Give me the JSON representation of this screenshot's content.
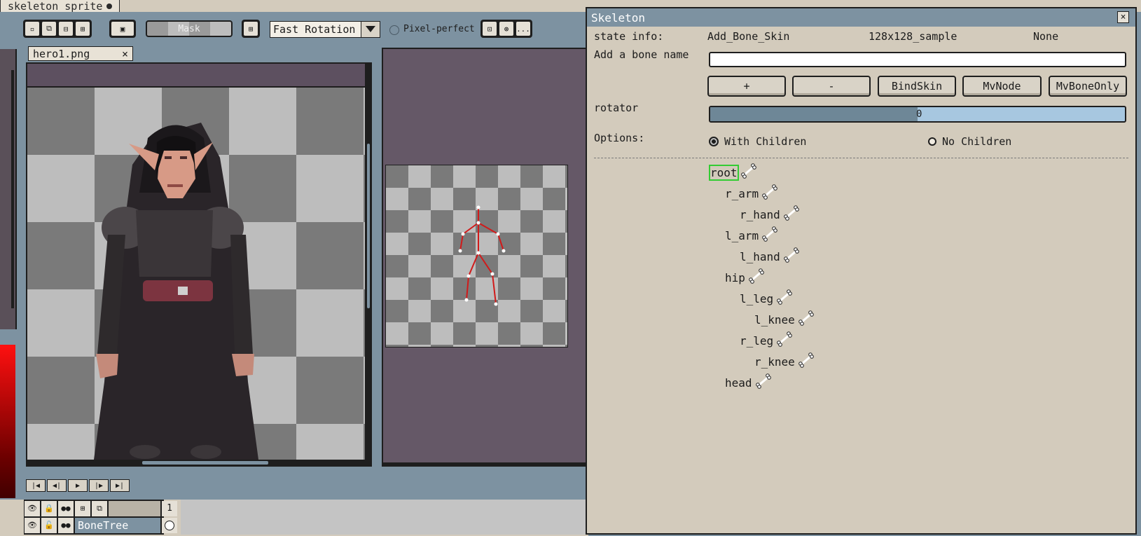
{
  "tab": {
    "title": "skeleton_sprite"
  },
  "toolbar": {
    "mask_label": "Mask",
    "rotation_mode": "Fast Rotation",
    "pixel_perfect_label": "Pixel-perfect",
    "more_label": "..."
  },
  "sprite": {
    "filename": "hero1.png",
    "close": "×"
  },
  "timeline": {
    "frame_number": "1",
    "layers": [
      {
        "name": ""
      },
      {
        "name": "BoneTree"
      }
    ]
  },
  "skeleton": {
    "title": "Skeleton",
    "close": "×",
    "state_info_label": "state info:",
    "state_info_values": [
      "Add_Bone_Skin",
      "128x128_sample",
      "None"
    ],
    "add_bone_label": "Add a bone name",
    "add_bone_value": "",
    "buttons": [
      "+",
      "-",
      "BindSkin",
      "MvNode",
      "MvBoneOnly"
    ],
    "rotator_label": "rotator",
    "rotator_value": "0",
    "rotator_fraction": 0.5,
    "options_label": "Options:",
    "option_with": "With Children",
    "option_without": "No Children",
    "selected_option": "With Children",
    "bones": [
      {
        "name": "root",
        "depth": 0,
        "selected": true
      },
      {
        "name": "r_arm",
        "depth": 1
      },
      {
        "name": "r_hand",
        "depth": 2
      },
      {
        "name": "l_arm",
        "depth": 1
      },
      {
        "name": "l_hand",
        "depth": 2
      },
      {
        "name": "hip",
        "depth": 1
      },
      {
        "name": "l_leg",
        "depth": 2
      },
      {
        "name": "l_knee",
        "depth": 3
      },
      {
        "name": "r_leg",
        "depth": 2
      },
      {
        "name": "r_knee",
        "depth": 3
      },
      {
        "name": "head",
        "depth": 1
      }
    ]
  },
  "colors": {
    "panel_bg": "#d3cbbc",
    "title_bar": "#7d92a1",
    "preview_bg": "#655867",
    "bone_line": "#d11a1a",
    "selection": "#33cc33"
  }
}
